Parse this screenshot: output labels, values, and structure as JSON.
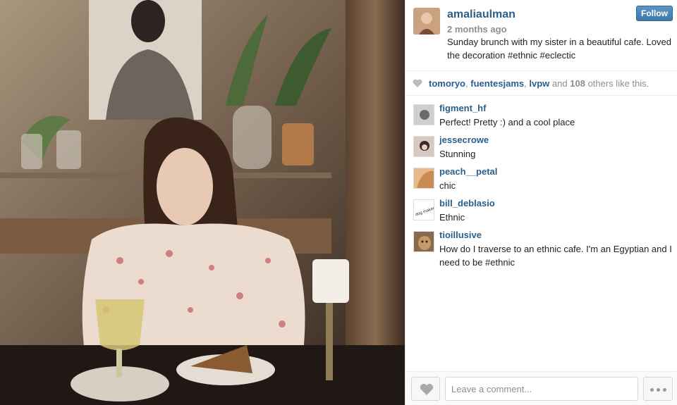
{
  "post": {
    "username": "amaliaulman",
    "time": "2 months ago",
    "caption": "Sunday brunch with my sister in a beautiful cafe. Loved the decoration #ethnic #eclectic",
    "follow_label": "Follow",
    "photo_icon": "cafe-photo"
  },
  "likes": {
    "user1": "tomoryo",
    "sep1": ",",
    "user2": "fuentesjams",
    "sep2": ",",
    "user3": "lvpw",
    "and": "and",
    "count": "108",
    "suffix": "others like this."
  },
  "comments": [
    {
      "user": "figment_hf",
      "text": "Perfect! Pretty :) and a cool place"
    },
    {
      "user": "jessecrowe",
      "text": "Stunning"
    },
    {
      "user": "peach__petal",
      "text": "chic"
    },
    {
      "user": "bill_deblasio",
      "text": "Ethnic",
      "avatar_text": "dog maker"
    },
    {
      "user": "tioillusive",
      "text": "How do I traverse to an ethnic cafe. I'm an Egyptian and I need to be #ethnic"
    }
  ],
  "footer": {
    "comment_placeholder": "Leave a comment..."
  },
  "colors": {
    "link": "#2a5f8a",
    "muted": "#8e8e8e",
    "follow": "#4a84b5"
  }
}
